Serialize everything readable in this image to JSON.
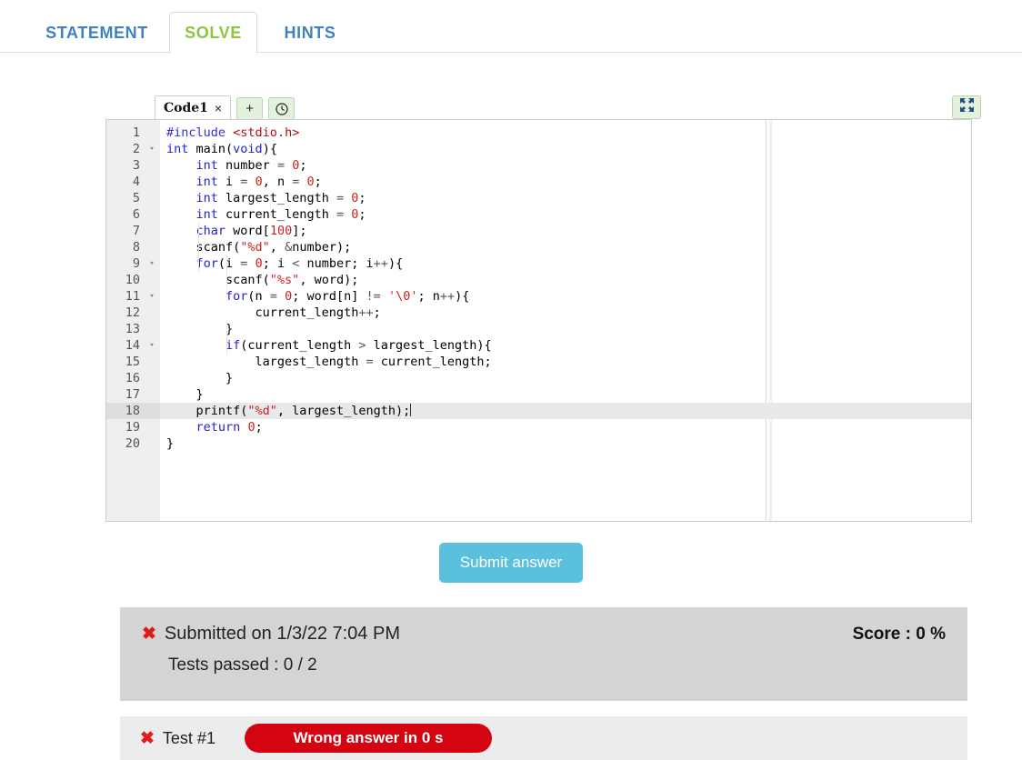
{
  "nav": {
    "tabs": [
      {
        "label": "STATEMENT",
        "active": false
      },
      {
        "label": "SOLVE",
        "active": true
      },
      {
        "label": "HINTS",
        "active": false
      }
    ]
  },
  "editor": {
    "file_tab": {
      "name": "Code1",
      "close": "×"
    },
    "add_tab_label": "+",
    "history_icon": "clock-icon",
    "expand_icon": "fullscreen-icon",
    "lines": [
      {
        "n": "1",
        "fold": "",
        "text": "#include <stdio.h>"
      },
      {
        "n": "2",
        "fold": "▾",
        "text": "int main(void){"
      },
      {
        "n": "3",
        "fold": "",
        "text": "    int number = 0;"
      },
      {
        "n": "4",
        "fold": "",
        "text": "    int i = 0, n = 0;"
      },
      {
        "n": "5",
        "fold": "",
        "text": "    int largest_length = 0;"
      },
      {
        "n": "6",
        "fold": "",
        "text": "    int current_length = 0;"
      },
      {
        "n": "7",
        "fold": "",
        "text": "    char word[100];"
      },
      {
        "n": "8",
        "fold": "",
        "text": "    scanf(\"%d\", &number);"
      },
      {
        "n": "9",
        "fold": "▾",
        "text": "    for(i = 0; i < number; i++){"
      },
      {
        "n": "10",
        "fold": "",
        "text": "        scanf(\"%s\", word);"
      },
      {
        "n": "11",
        "fold": "▾",
        "text": "        for(n = 0; word[n] != '\\0'; n++){"
      },
      {
        "n": "12",
        "fold": "",
        "text": "            current_length++;"
      },
      {
        "n": "13",
        "fold": "",
        "text": "        }"
      },
      {
        "n": "14",
        "fold": "▾",
        "text": "        if(current_length > largest_length){"
      },
      {
        "n": "15",
        "fold": "",
        "text": "            largest_length = current_length;"
      },
      {
        "n": "16",
        "fold": "",
        "text": "        }"
      },
      {
        "n": "17",
        "fold": "",
        "text": "    }"
      },
      {
        "n": "18",
        "fold": "",
        "text": "    printf(\"%d\", largest_length);"
      },
      {
        "n": "19",
        "fold": "",
        "text": "    return 0;"
      },
      {
        "n": "20",
        "fold": "",
        "text": "}"
      }
    ],
    "active_line": "18"
  },
  "submit": {
    "label": "Submit answer"
  },
  "results": {
    "status_icon": "x-mark-icon",
    "submitted_on": "Submitted on 1/3/22 7:04 PM",
    "score": "Score : 0 %",
    "tests_passed": "Tests passed : 0 / 2",
    "tests": [
      {
        "icon": "x-mark-icon",
        "name": "Test #1",
        "verdict": "Wrong answer in 0 s"
      }
    ]
  },
  "colors": {
    "accent_blue": "#3f82bf",
    "active_tab_green": "#8cc63e",
    "submit_blue": "#5bc0de",
    "fail_red": "#d40511",
    "x_red": "#e01b1b",
    "summary_gray": "#d4d4d4",
    "test_row_gray": "#ececec"
  }
}
